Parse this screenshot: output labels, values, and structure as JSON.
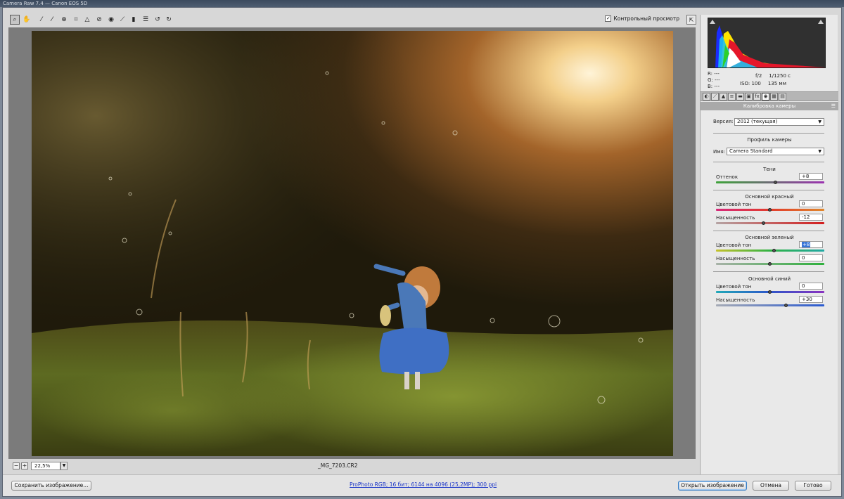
{
  "app": {
    "title": "Camera Raw 7.4 — Canon EOS 5D"
  },
  "toolbar": {
    "tools": [
      "zoom-tool-icon",
      "hand-tool-icon",
      "white-balance-tool-icon",
      "color-sampler-tool-icon",
      "targeted-adjustment-tool-icon",
      "crop-tool-icon",
      "straighten-tool-icon",
      "spot-removal-tool-icon",
      "red-eye-tool-icon",
      "adjustment-brush-icon",
      "graduated-filter-icon",
      "open-preferences-icon",
      "rotate-ccw-icon",
      "rotate-cw-icon"
    ],
    "preview_label": "Контрольный просмотр",
    "preview_checked": true
  },
  "canvas": {
    "zoom_value": "22,5%",
    "filename": "_MG_7203.CR2"
  },
  "histogram": {
    "r_label": "R:",
    "g_label": "G:",
    "b_label": "B:",
    "r_value": "---",
    "g_value": "---",
    "b_value": "---",
    "aperture": "f/2",
    "shutter": "1/1250 с",
    "iso": "ISO: 100",
    "focal": "135 мм"
  },
  "panel": {
    "title": "Калибровка камеры",
    "version_label": "Версия:",
    "version_value": "2012 (текущая)",
    "profile_header": "Профиль камеры",
    "name_label": "Имя:",
    "name_value": "Camera Standard",
    "shadows": {
      "header": "Тени",
      "tint_label": "Оттенок",
      "tint_value": "+8",
      "tint_pos": 0.55
    },
    "red": {
      "header": "Основной красный",
      "hue_label": "Цветовой тон",
      "hue_value": "0",
      "hue_pos": 0.5,
      "sat_label": "Насыщенность",
      "sat_value": "-12",
      "sat_pos": 0.44
    },
    "green": {
      "header": "Основной зеленый",
      "hue_label": "Цветовой тон",
      "hue_value": "+8",
      "hue_pos": 0.54,
      "sat_label": "Насыщенность",
      "sat_value": "0",
      "sat_pos": 0.5
    },
    "blue": {
      "header": "Основной синий",
      "hue_label": "Цветовой тон",
      "hue_value": "0",
      "hue_pos": 0.5,
      "sat_label": "Насыщенность",
      "sat_value": "+30",
      "sat_pos": 0.65
    }
  },
  "footer": {
    "save_label": "Сохранить изображение...",
    "workflow_link": "ProPhoto RGB; 16 бит; 6144 на 4096 (25,2МР); 300 ppi",
    "open_label": "Открыть изображение",
    "cancel_label": "Отмена",
    "done_label": "Готово"
  },
  "colors": {
    "accent": "#3875d7",
    "panel_bg": "#e9e9e9"
  }
}
